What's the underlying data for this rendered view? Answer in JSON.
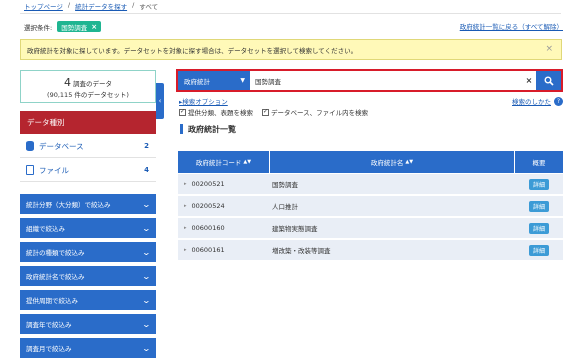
{
  "breadcrumb": [
    "トップページ",
    "統計データを探す",
    "すべて"
  ],
  "condition": {
    "label": "選択条件:",
    "tag": "国勢調査",
    "tag_close": "×"
  },
  "back_link": "政府統計一覧に戻る（すべて解除）",
  "notice": {
    "text": "政府統計を対象に探しています。データセットを対象に探す場合は、データセットを選択して検索してください。",
    "close": "×"
  },
  "count": {
    "num": "4",
    "unit": "調査のデータ",
    "sub": "(90,115 件のデータセット)"
  },
  "collapse_glyph": "‹",
  "sidebar": {
    "header": "データ種別",
    "items": [
      {
        "label": "データベース",
        "count": "2",
        "icon": "database-icon"
      },
      {
        "label": "ファイル",
        "count": "4",
        "icon": "file-icon"
      }
    ],
    "filters": [
      "統計分野（大分類）で絞込み",
      "組織で絞込み",
      "統計の種類で絞込み",
      "政府統計名で絞込み",
      "提供周期で絞込み",
      "調査年で絞込み",
      "調査月で絞込み"
    ],
    "filter_chevron": "⌄"
  },
  "search": {
    "scope": "政府統計",
    "scope_arrow": "▼",
    "value": "国勢調査",
    "clear": "×"
  },
  "search_option": "▸検索オプション",
  "howto": {
    "label": "検索のしかた",
    "icon_glyph": "?"
  },
  "checks": [
    {
      "label": "提供分類、表題を検索",
      "checked": "✓"
    },
    {
      "label": "データベース、ファイル内を検索",
      "checked": "✓"
    }
  ],
  "list_title": "政府統計一覧",
  "table": {
    "headers": [
      "政府統計コード",
      "政府統計名",
      "概要"
    ],
    "sort_glyph": "▲▼",
    "row_arrow": "▸",
    "detail_label": "詳細",
    "rows": [
      {
        "code": "00200521",
        "name": "国勢調査"
      },
      {
        "code": "00200524",
        "name": "人口推計"
      },
      {
        "code": "00600160",
        "name": "建築物実態調査"
      },
      {
        "code": "00600161",
        "name": "増改築・改装等調査"
      }
    ]
  },
  "colors": {
    "accent": "#2a6cc9",
    "danger": "#b5252f",
    "tag": "#1fb591",
    "notice_bg": "#fff9b8"
  }
}
